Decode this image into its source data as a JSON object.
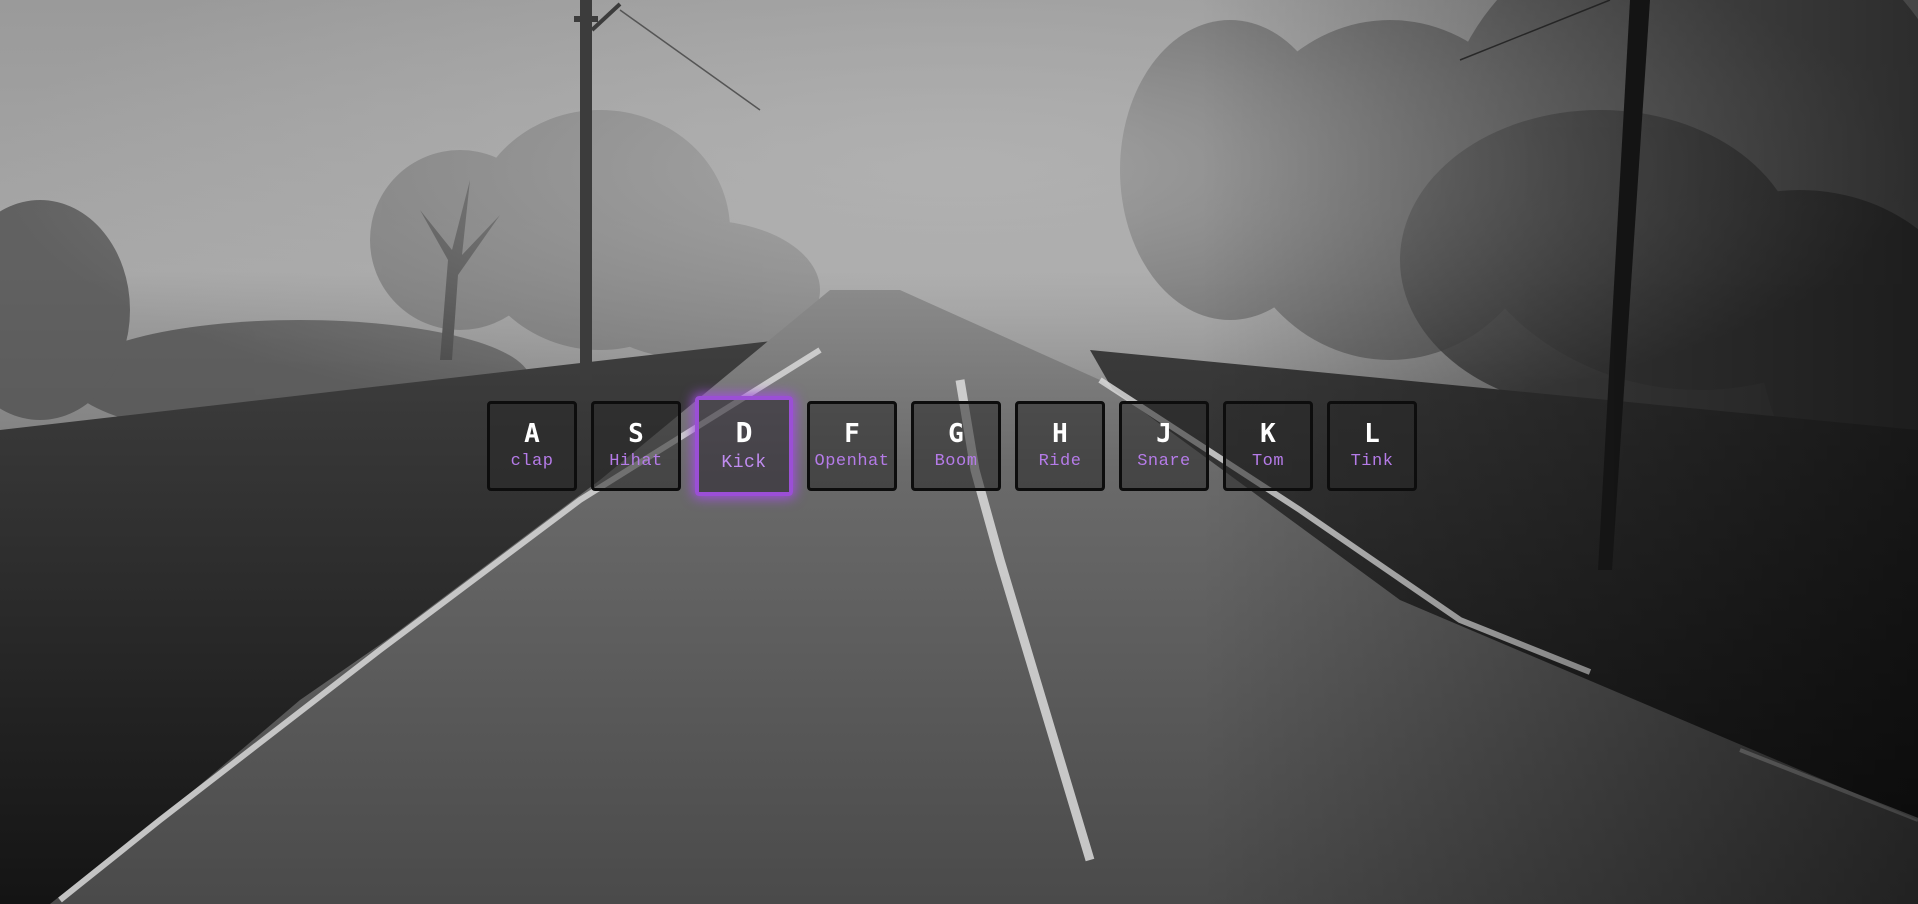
{
  "drum_kit": {
    "keys": [
      {
        "letter": "A",
        "sound": "clap",
        "playing": false
      },
      {
        "letter": "S",
        "sound": "Hihat",
        "playing": false
      },
      {
        "letter": "D",
        "sound": "Kick",
        "playing": true
      },
      {
        "letter": "F",
        "sound": "Openhat",
        "playing": false
      },
      {
        "letter": "G",
        "sound": "Boom",
        "playing": false
      },
      {
        "letter": "H",
        "sound": "Ride",
        "playing": false
      },
      {
        "letter": "J",
        "sound": "Snare",
        "playing": false
      },
      {
        "letter": "K",
        "sound": "Tom",
        "playing": false
      },
      {
        "letter": "L",
        "sound": "Tink",
        "playing": false
      }
    ]
  },
  "colors": {
    "accent": "#b57be8",
    "active_border": "#9b4fd6",
    "key_border": "#0d0d0d",
    "letter": "#ffffff"
  }
}
